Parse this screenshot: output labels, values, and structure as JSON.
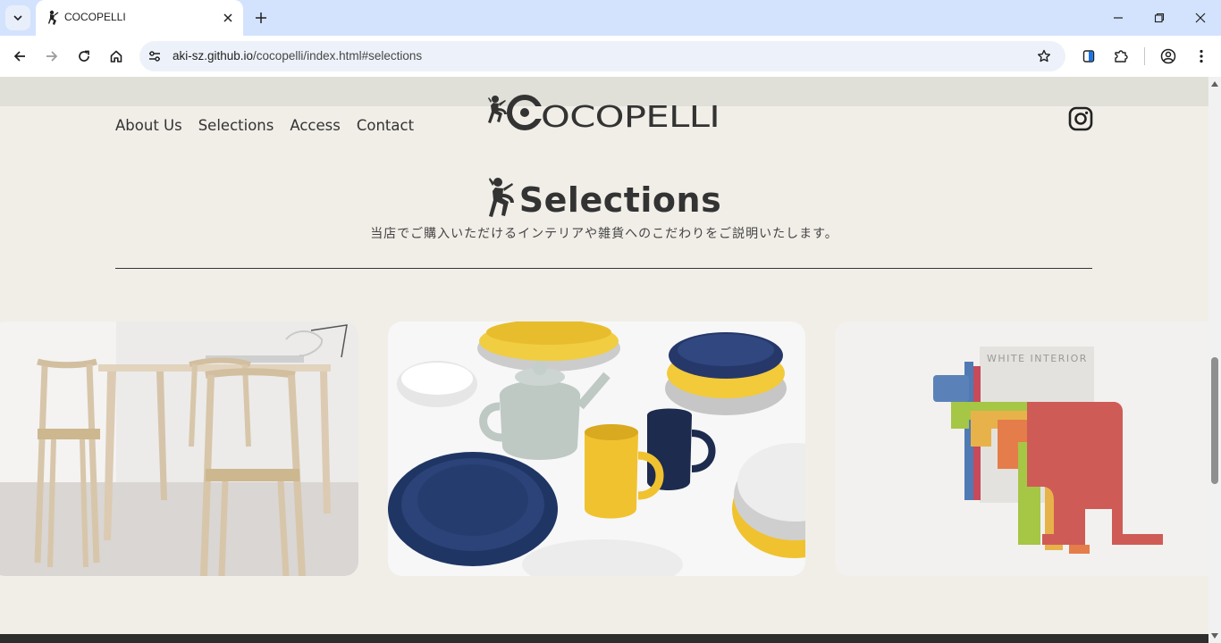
{
  "browser": {
    "tab_title": "COCOPELLI",
    "url_host": "aki-sz.github.io",
    "url_path": "/cocopelli/index.html#selections"
  },
  "site": {
    "brand": "COCOPELLI",
    "nav": [
      "About Us",
      "Selections",
      "Access",
      "Contact"
    ],
    "section_title": "Selections",
    "section_desc": "当店でご購入いただけるインテリアや雑貨へのこだわりをご説明いたします。"
  },
  "colors": {
    "page_bg": "#f1eee8",
    "header_band": "#e0e0d8",
    "text": "#333333",
    "tabstrip": "#d3e3fd",
    "omnibox": "#edf2fa"
  },
  "icons": {
    "tab_search": "chevron-down-icon",
    "new_tab": "plus-icon",
    "back": "arrow-left-icon",
    "forward": "arrow-right-icon",
    "reload": "reload-icon",
    "home": "home-icon",
    "site_info": "tune-icon",
    "bookmark": "star-icon",
    "social": "instagram-icon"
  }
}
